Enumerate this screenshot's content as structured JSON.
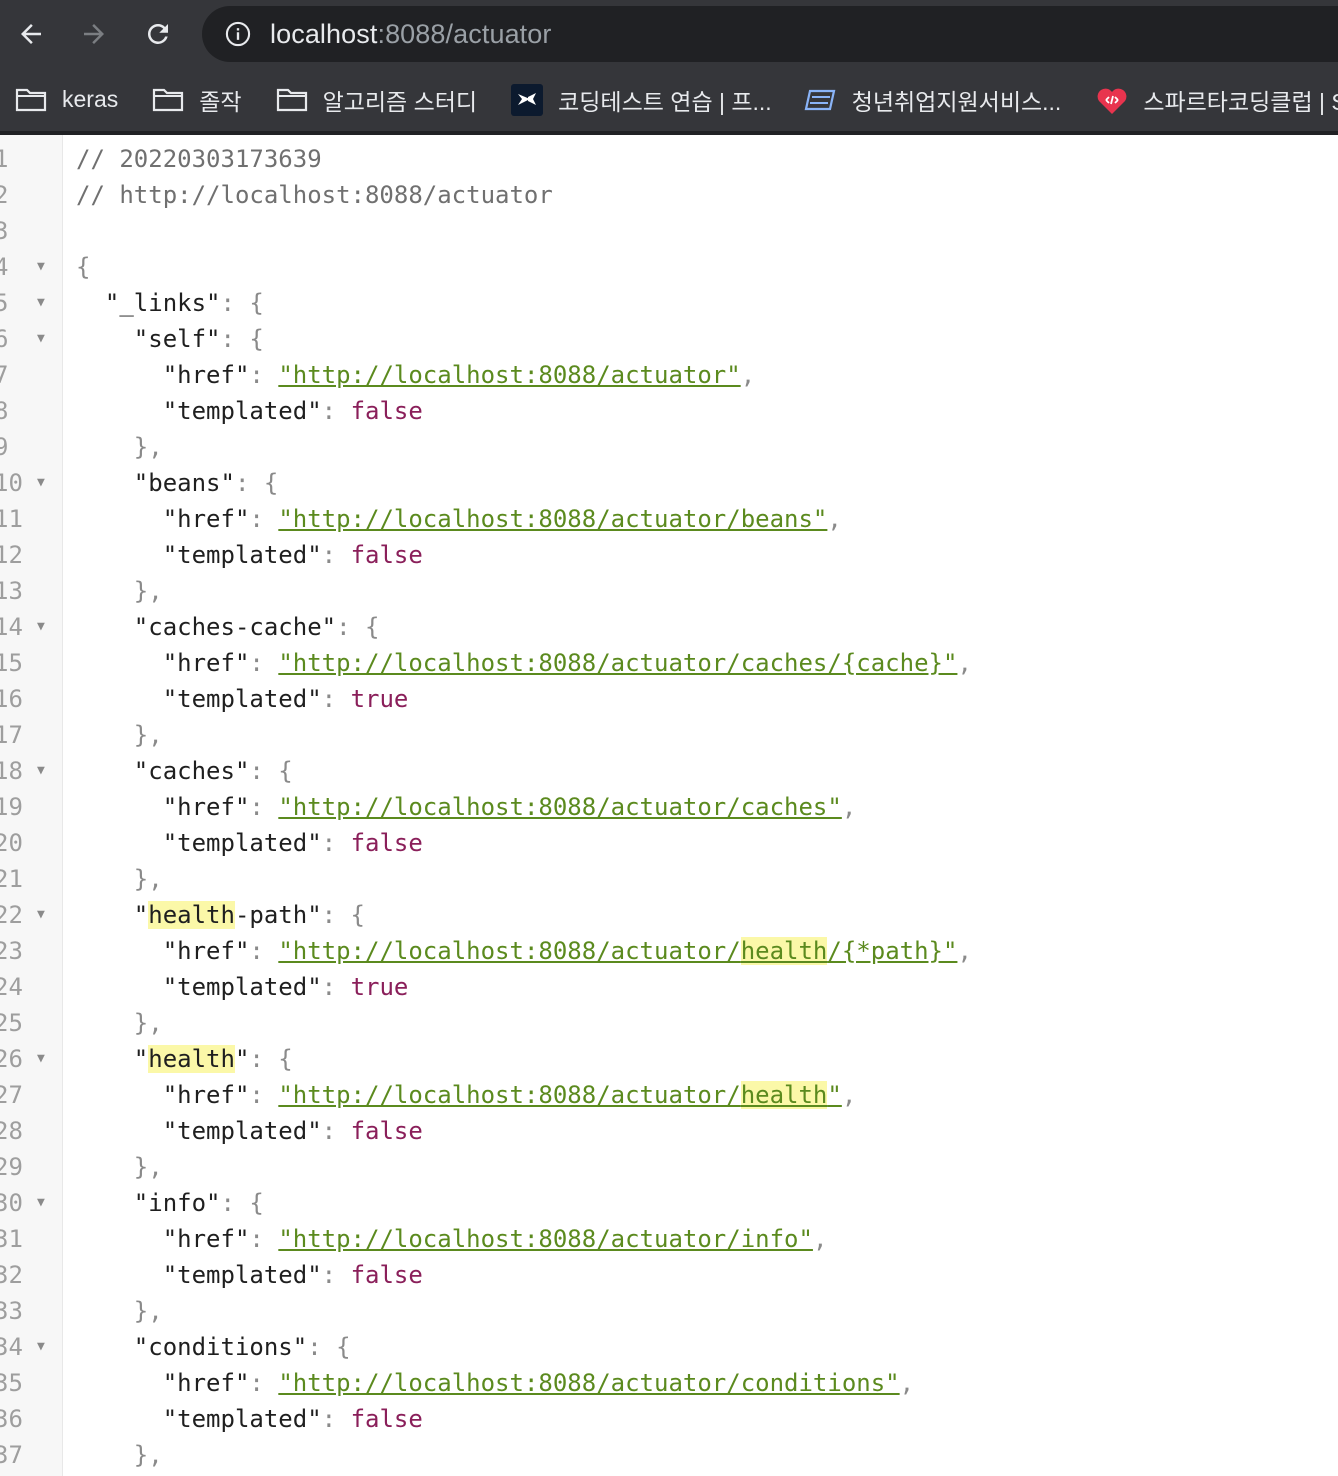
{
  "browser": {
    "url_host": "localhost",
    "url_rest": ":8088/actuator"
  },
  "bookmarks": [
    {
      "label": "keras",
      "icon": "folder-icon"
    },
    {
      "label": "졸작",
      "icon": "folder-icon"
    },
    {
      "label": "알고리즘 스터디",
      "icon": "folder-icon"
    },
    {
      "label": "코딩테스트 연습 | 프...",
      "icon": "programmers-icon"
    },
    {
      "label": "청년취업지원서비스...",
      "icon": "worknet-icon"
    },
    {
      "label": "스파르타코딩클럽 | S",
      "icon": "sparta-icon"
    }
  ],
  "colors": {
    "chrome_bg": "#35363a",
    "omnibox_bg": "#202124",
    "link_green": "#5b8a1e",
    "bool_purple": "#8a1f5a",
    "search_highlight": "#fbf8a8"
  },
  "document": {
    "comments": [
      "// 20220303173639",
      "// http://localhost:8088/actuator"
    ],
    "root_key": "_links",
    "entries": [
      {
        "key": "self",
        "href": "http://localhost:8088/actuator",
        "templated": "false"
      },
      {
        "key": "beans",
        "href": "http://localhost:8088/actuator/beans",
        "templated": "false"
      },
      {
        "key": "caches-cache",
        "href": "http://localhost:8088/actuator/caches/{cache}",
        "templated": "true"
      },
      {
        "key": "caches",
        "href": "http://localhost:8088/actuator/caches",
        "templated": "false"
      },
      {
        "key": "health-path",
        "href": "http://localhost:8088/actuator/health/{*path}",
        "templated": "true"
      },
      {
        "key": "health",
        "href": "http://localhost:8088/actuator/health",
        "templated": "false"
      },
      {
        "key": "info",
        "href": "http://localhost:8088/actuator/info",
        "templated": "false"
      },
      {
        "key": "conditions",
        "href": "http://localhost:8088/actuator/conditions",
        "templated": "false"
      }
    ],
    "highlight_term": "health"
  }
}
